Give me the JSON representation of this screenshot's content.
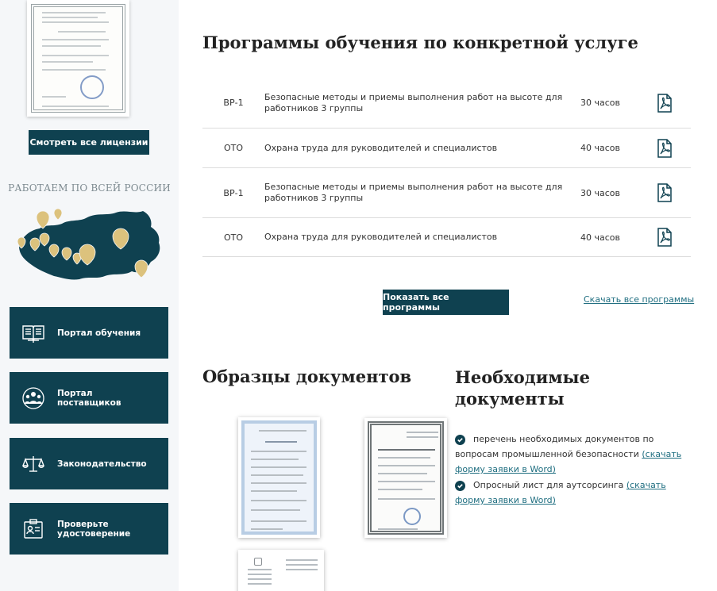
{
  "sidebar": {
    "licenses_button": "Смотреть все лицензии",
    "russia_caption": "РАБОТАЕМ ПО ВСЕЙ РОССИИ",
    "portals": [
      {
        "label": "Портал обучения",
        "icon": "book-icon"
      },
      {
        "label": "Портал поставщиков",
        "icon": "people-icon"
      },
      {
        "label": "Законодательство",
        "icon": "scales-icon"
      },
      {
        "label": "Проверьте удостоверение",
        "icon": "id-card-icon"
      }
    ]
  },
  "programs": {
    "title": "Программы обучения по конкретной услуге",
    "rows": [
      {
        "code": "ВР-1",
        "name": "Безопасные методы и приемы выполнения работ на высоте для работников 3 группы",
        "hours": "30 часов"
      },
      {
        "code": "ОТО",
        "name": "Охрана труда для руководителей и специалистов",
        "hours": "40 часов"
      },
      {
        "code": "ВР-1",
        "name": "Безопасные методы и приемы выполнения работ на высоте для работников 3 группы",
        "hours": "30 часов"
      },
      {
        "code": "ОТО",
        "name": "Охрана труда для руководителей и специалистов",
        "hours": "40 часов"
      }
    ],
    "show_all_button": "Показать все программы",
    "download_all_link": "Скачать все программы"
  },
  "samples": {
    "title": "Образцы документов"
  },
  "needed": {
    "title": "Необходимые документы",
    "items": [
      {
        "text": "перечень необходимых документов по вопросам промышленной безопасности",
        "link": "(скачать форму заявки в Word)"
      },
      {
        "text": "Опросный лист для аутсорсинга",
        "link": "(скачать форму заявки в Word)"
      }
    ]
  },
  "colors": {
    "primary": "#0f4150",
    "gold": "#dcc27d",
    "link": "#1f6e80",
    "sidebar_bg": "#f5f7f9"
  }
}
